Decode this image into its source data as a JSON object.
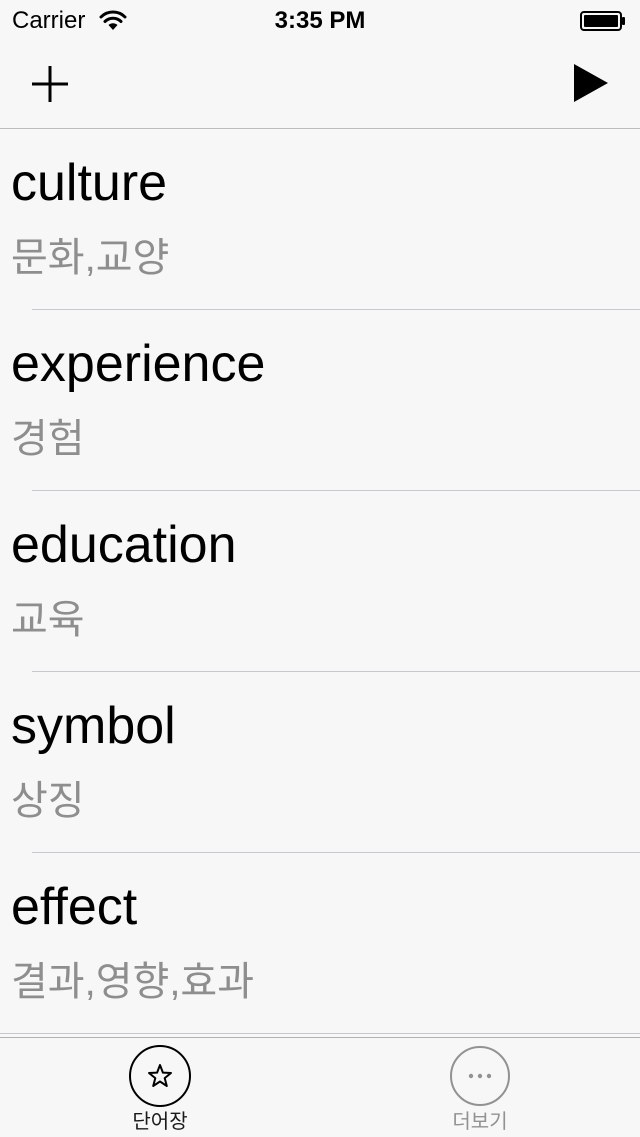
{
  "status_bar": {
    "carrier": "Carrier",
    "time": "3:35 PM",
    "wifi_icon": "wifi-icon",
    "battery_icon": "battery-icon"
  },
  "nav_bar": {
    "left_icon": "plus-icon",
    "right_icon": "play-icon"
  },
  "words": [
    {
      "word": "culture",
      "meaning": "문화,교양"
    },
    {
      "word": "experience",
      "meaning": "경험"
    },
    {
      "word": "education",
      "meaning": "교육"
    },
    {
      "word": "symbol",
      "meaning": "상징"
    },
    {
      "word": "effect",
      "meaning": "결과,영향,효과"
    }
  ],
  "tab_bar": {
    "tabs": [
      {
        "label": "단어장",
        "icon": "star-icon",
        "selected": true
      },
      {
        "label": "더보기",
        "icon": "more-icon",
        "selected": false
      }
    ]
  },
  "colors": {
    "background": "#f7f7f7",
    "meaning_text": "#8e8e8e",
    "separator": "#c8c7cc",
    "inactive_tab": "#929292"
  }
}
